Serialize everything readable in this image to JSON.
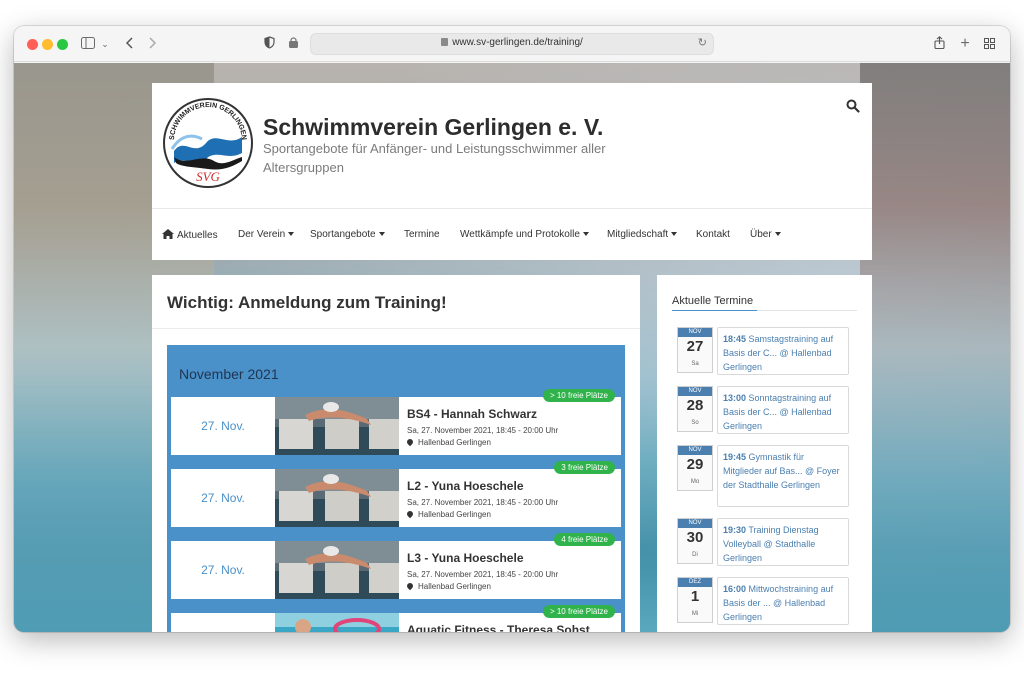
{
  "browser": {
    "url": "www.sv-gerlingen.de/training/"
  },
  "site": {
    "title": "Schwimmverein Gerlingen e. V.",
    "subtitle": "Sportangebote für Anfänger- und Leistungsschwimmer aller Altersgruppen",
    "logo_text_top": "SCHWIMMVEREIN GERLINGEN",
    "logo_text_bottom": "SVG"
  },
  "nav": {
    "items": [
      {
        "label": "Aktuelles"
      },
      {
        "label": "Der Verein"
      },
      {
        "label": "Sportangebote"
      },
      {
        "label": "Termine"
      },
      {
        "label": "Wettkämpfe und Protokolle"
      },
      {
        "label": "Mitgliedschaft"
      },
      {
        "label": "Kontakt"
      },
      {
        "label": "Über"
      }
    ]
  },
  "main": {
    "title": "Wichtig: Anmeldung zum Training!",
    "month": "November 2021",
    "events": [
      {
        "date": "27. Nov.",
        "title": "BS4 - Hannah Schwarz",
        "time": "Sa, 27. November 2021, 18:45 - 20:00 Uhr",
        "location": "Hallenbad Gerlingen",
        "badge": "> 10 freie Plätze"
      },
      {
        "date": "27. Nov.",
        "title": "L2 - Yuna Hoeschele",
        "time": "Sa, 27. November 2021, 18:45 - 20:00 Uhr",
        "location": "Hallenbad Gerlingen",
        "badge": "3 freie Plätze"
      },
      {
        "date": "27. Nov.",
        "title": "L3 - Yuna Hoeschele",
        "time": "Sa, 27. November 2021, 18:45 - 20:00 Uhr",
        "location": "Hallenbad Gerlingen",
        "badge": "4 freie Plätze"
      },
      {
        "date": "",
        "title": "Aquatic Fitness - Theresa Sohst",
        "time": "",
        "location": "",
        "badge": "> 10 freie Plätze"
      }
    ]
  },
  "sidebar": {
    "title": "Aktuelle Termine",
    "items": [
      {
        "month": "NOV",
        "day": "27",
        "weekday": "Sa",
        "time": "18:45",
        "text": "Samstagstraining auf Basis der C... @ Hallenbad Gerlingen"
      },
      {
        "month": "NOV",
        "day": "28",
        "weekday": "So",
        "time": "13:00",
        "text": "Sonntagstraining auf Basis der C... @ Hallenbad Gerlingen"
      },
      {
        "month": "NOV",
        "day": "29",
        "weekday": "Mo",
        "time": "19:45",
        "text": "Gymnastik für Mitglieder auf Bas... @ Foyer der Stadthalle Gerlingen"
      },
      {
        "month": "NOV",
        "day": "30",
        "weekday": "Di",
        "time": "19:30",
        "text": "Training Dienstag Volleyball @ Stadthalle Gerlingen"
      },
      {
        "month": "DEZ",
        "day": "1",
        "weekday": "Mi",
        "time": "16:00",
        "text": "Mittwochstraining auf Basis der ... @ Hallenbad Gerlingen"
      }
    ]
  },
  "colors": {
    "accent": "#4a90c9",
    "badge": "#2fb34a"
  },
  "icons": {
    "search": "search-icon",
    "home": "home-icon",
    "pin": "map-pin-icon"
  }
}
